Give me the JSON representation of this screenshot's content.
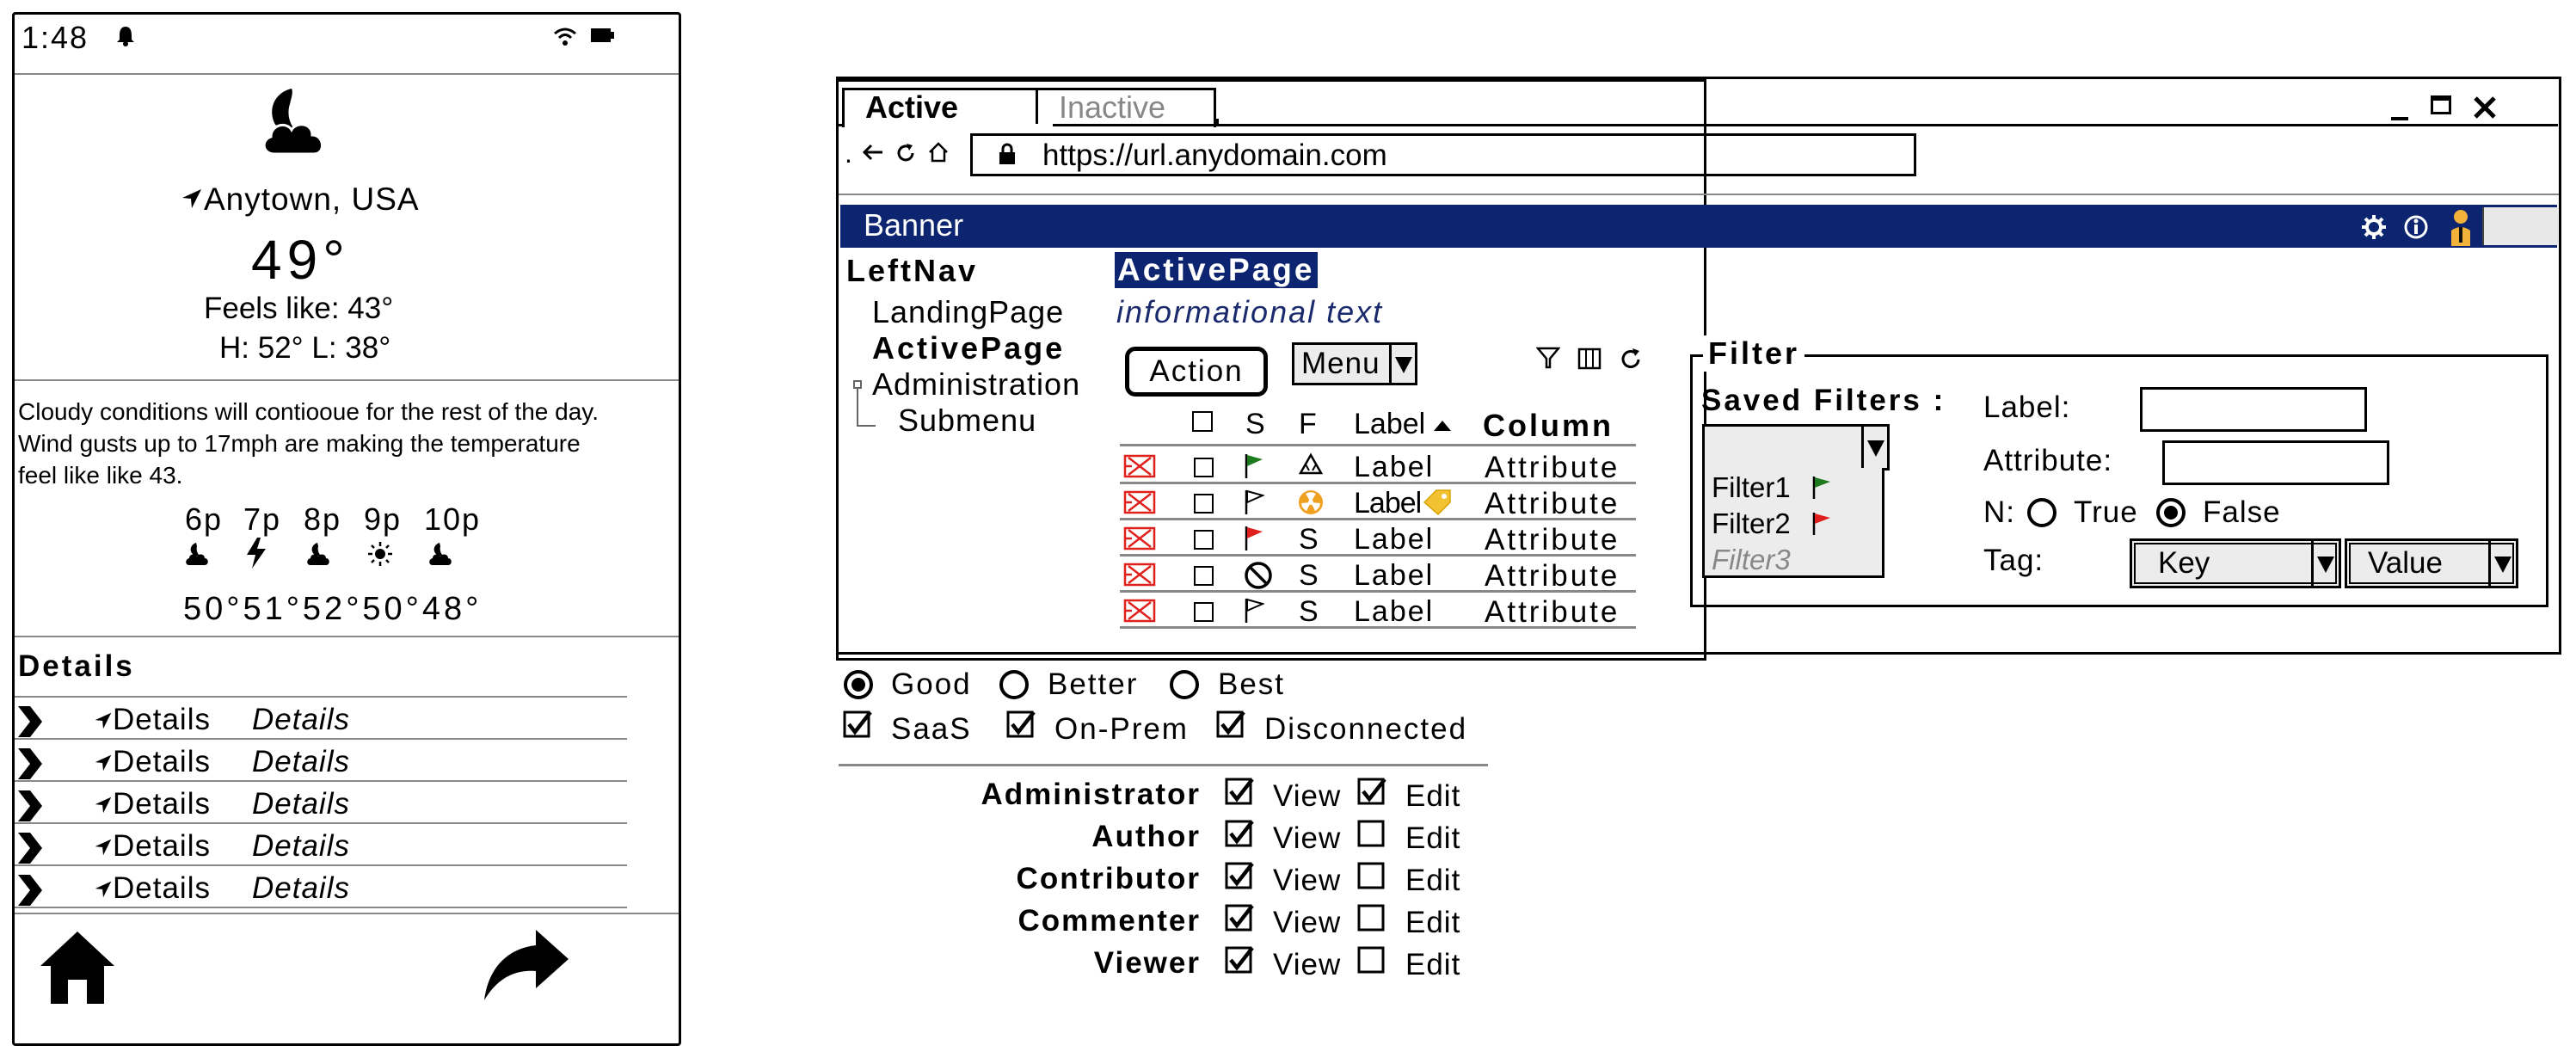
{
  "phone": {
    "status_time": "1:48",
    "location": "Anytown, USA",
    "temperature": "49°",
    "feels_like": "Feels like: 43°",
    "high_low": "H: 52° L: 38°",
    "description": [
      "Cloudy conditions will contiooue for the rest of the day.",
      "Wind gusts up to 17mph are making the temperature",
      "feel like like 43."
    ],
    "hours": [
      "6p",
      "7p",
      "8p",
      "9p",
      "10p"
    ],
    "hour_icons": [
      "cloud-icon",
      "lightning-icon",
      "cloud-icon",
      "sun-icon",
      "cloud-icon"
    ],
    "hour_temps": "50°51°52°50°48°",
    "details_title": "Details",
    "details": [
      {
        "label": "Details",
        "value": "Details"
      },
      {
        "label": "Details",
        "value": "Details"
      },
      {
        "label": "Details",
        "value": "Details"
      },
      {
        "label": "Details",
        "value": "Details"
      },
      {
        "label": "Details",
        "value": "Details"
      }
    ]
  },
  "browser": {
    "tabs": {
      "active": "Active",
      "inactive": "Inactive"
    },
    "url": "https://url.anydomain.com",
    "banner": "Banner",
    "banner_color": "#0d2570",
    "leftnav": {
      "title": "LeftNav",
      "items": [
        "LandingPage",
        "ActivePage",
        "Administration",
        "Submenu"
      ]
    },
    "page_title": "ActivePage",
    "info_text": "informational text",
    "action_button": "Action",
    "menu_button": "Menu",
    "table": {
      "headers": {
        "s": "S",
        "f": "F",
        "label": "Label",
        "column": "Column"
      },
      "rows": [
        {
          "s": "flag-green-icon",
          "f": "recycle-icon",
          "label": "Label",
          "attribute": "Attribute"
        },
        {
          "s": "flag-outline-icon",
          "f": "radiation-icon",
          "label": "Label",
          "attribute": "Attribute"
        },
        {
          "s": "flag-red-icon",
          "f": "S",
          "label": "Label",
          "attribute": "Attribute"
        },
        {
          "s": "no-entry-icon",
          "f": "S",
          "label": "Label",
          "attribute": "Attribute"
        },
        {
          "s": "flag-outline-icon",
          "f": "S",
          "label": "Label",
          "attribute": "Attribute"
        }
      ]
    },
    "filter": {
      "legend": "Filter",
      "saved_filters_label": "Saved Filters :",
      "saved_filters": [
        "Filter1",
        "Filter2",
        "Filter3"
      ],
      "label_field": "Label:",
      "attribute_field": "Attribute:",
      "n_label": "N:",
      "true_label": "True",
      "false_label": "False",
      "tag_label": "Tag:",
      "key_select": "Key",
      "value_select": "Value"
    }
  },
  "tiers": {
    "options": [
      "Good",
      "Better",
      "Best"
    ],
    "selected": "Good"
  },
  "deploy": {
    "options": [
      "SaaS",
      "On-Prem",
      "Disconnected"
    ]
  },
  "permissions": {
    "view_label": "View",
    "edit_label": "Edit",
    "rows": [
      {
        "role": "Administrator",
        "view": true,
        "edit": true
      },
      {
        "role": "Author",
        "view": true,
        "edit": false
      },
      {
        "role": "Contributor",
        "view": true,
        "edit": false
      },
      {
        "role": "Commenter",
        "view": true,
        "edit": false
      },
      {
        "role": "Viewer",
        "view": true,
        "edit": false
      }
    ]
  }
}
